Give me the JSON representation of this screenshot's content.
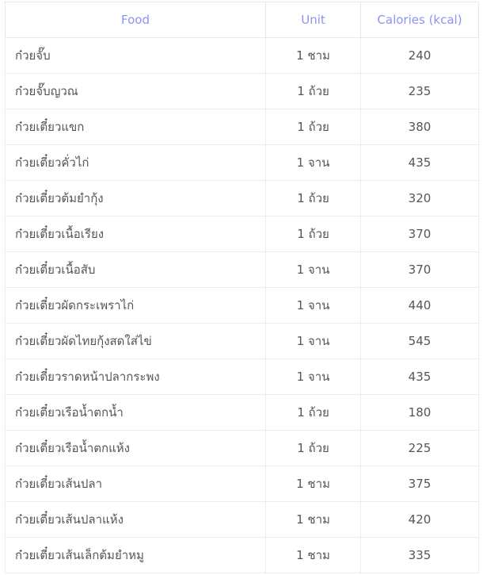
{
  "table": {
    "columns": [
      {
        "key": "food",
        "label": "Food",
        "align": "left"
      },
      {
        "key": "unit",
        "label": "Unit",
        "align": "center"
      },
      {
        "key": "calories",
        "label": "Calories (kcal)",
        "align": "center"
      }
    ],
    "header_color": "#8a95f2",
    "body_text_color": "#555555",
    "border_color": "#ededed",
    "rows": [
      {
        "food": "ก๋วยจั๊บ",
        "unit": "1 ชาม",
        "calories": "240"
      },
      {
        "food": "ก๋วยจั๊บญวณ",
        "unit": "1 ถ้วย",
        "calories": "235"
      },
      {
        "food": "ก๋วยเตี๋ยวแขก",
        "unit": "1 ถ้วย",
        "calories": "380"
      },
      {
        "food": "ก๋วยเตี๋ยวคั่วไก่",
        "unit": "1 จาน",
        "calories": "435"
      },
      {
        "food": "ก๋วยเตี๋ยวต้มยำกุ้ง",
        "unit": "1 ถ้วย",
        "calories": "320"
      },
      {
        "food": "ก๋วยเตี๋ยวเนื้อเรียง",
        "unit": "1 ถ้วย",
        "calories": "370"
      },
      {
        "food": "ก๋วยเตี๋ยวเนื้อสับ",
        "unit": "1 จาน",
        "calories": "370"
      },
      {
        "food": "ก๋วยเตี๋ยวผัดกระเพราไก่",
        "unit": "1 จาน",
        "calories": "440"
      },
      {
        "food": "ก๋วยเตี๋ยวผัดไทยกุ้งสดใส่ไข่",
        "unit": "1 จาน",
        "calories": "545"
      },
      {
        "food": "ก๋วยเตี๋ยวราดหน้าปลากระพง",
        "unit": "1 จาน",
        "calories": "435"
      },
      {
        "food": "ก๋วยเตี๋ยวเรือน้ำตกน้ำ",
        "unit": "1 ถ้วย",
        "calories": "180"
      },
      {
        "food": "ก๋วยเตี๋ยวเรือน้ำตกแห้ง",
        "unit": "1 ถ้วย",
        "calories": "225"
      },
      {
        "food": "ก๋วยเตี๋ยวเส้นปลา",
        "unit": "1 ชาม",
        "calories": "375"
      },
      {
        "food": "ก๋วยเตี๋ยวเส้นปลาแห้ง",
        "unit": "1 ชาม",
        "calories": "420"
      },
      {
        "food": "ก๋วยเตี๋ยวเส้นเล็กต้มยำหมู",
        "unit": "1 ชาม",
        "calories": "335"
      }
    ]
  }
}
